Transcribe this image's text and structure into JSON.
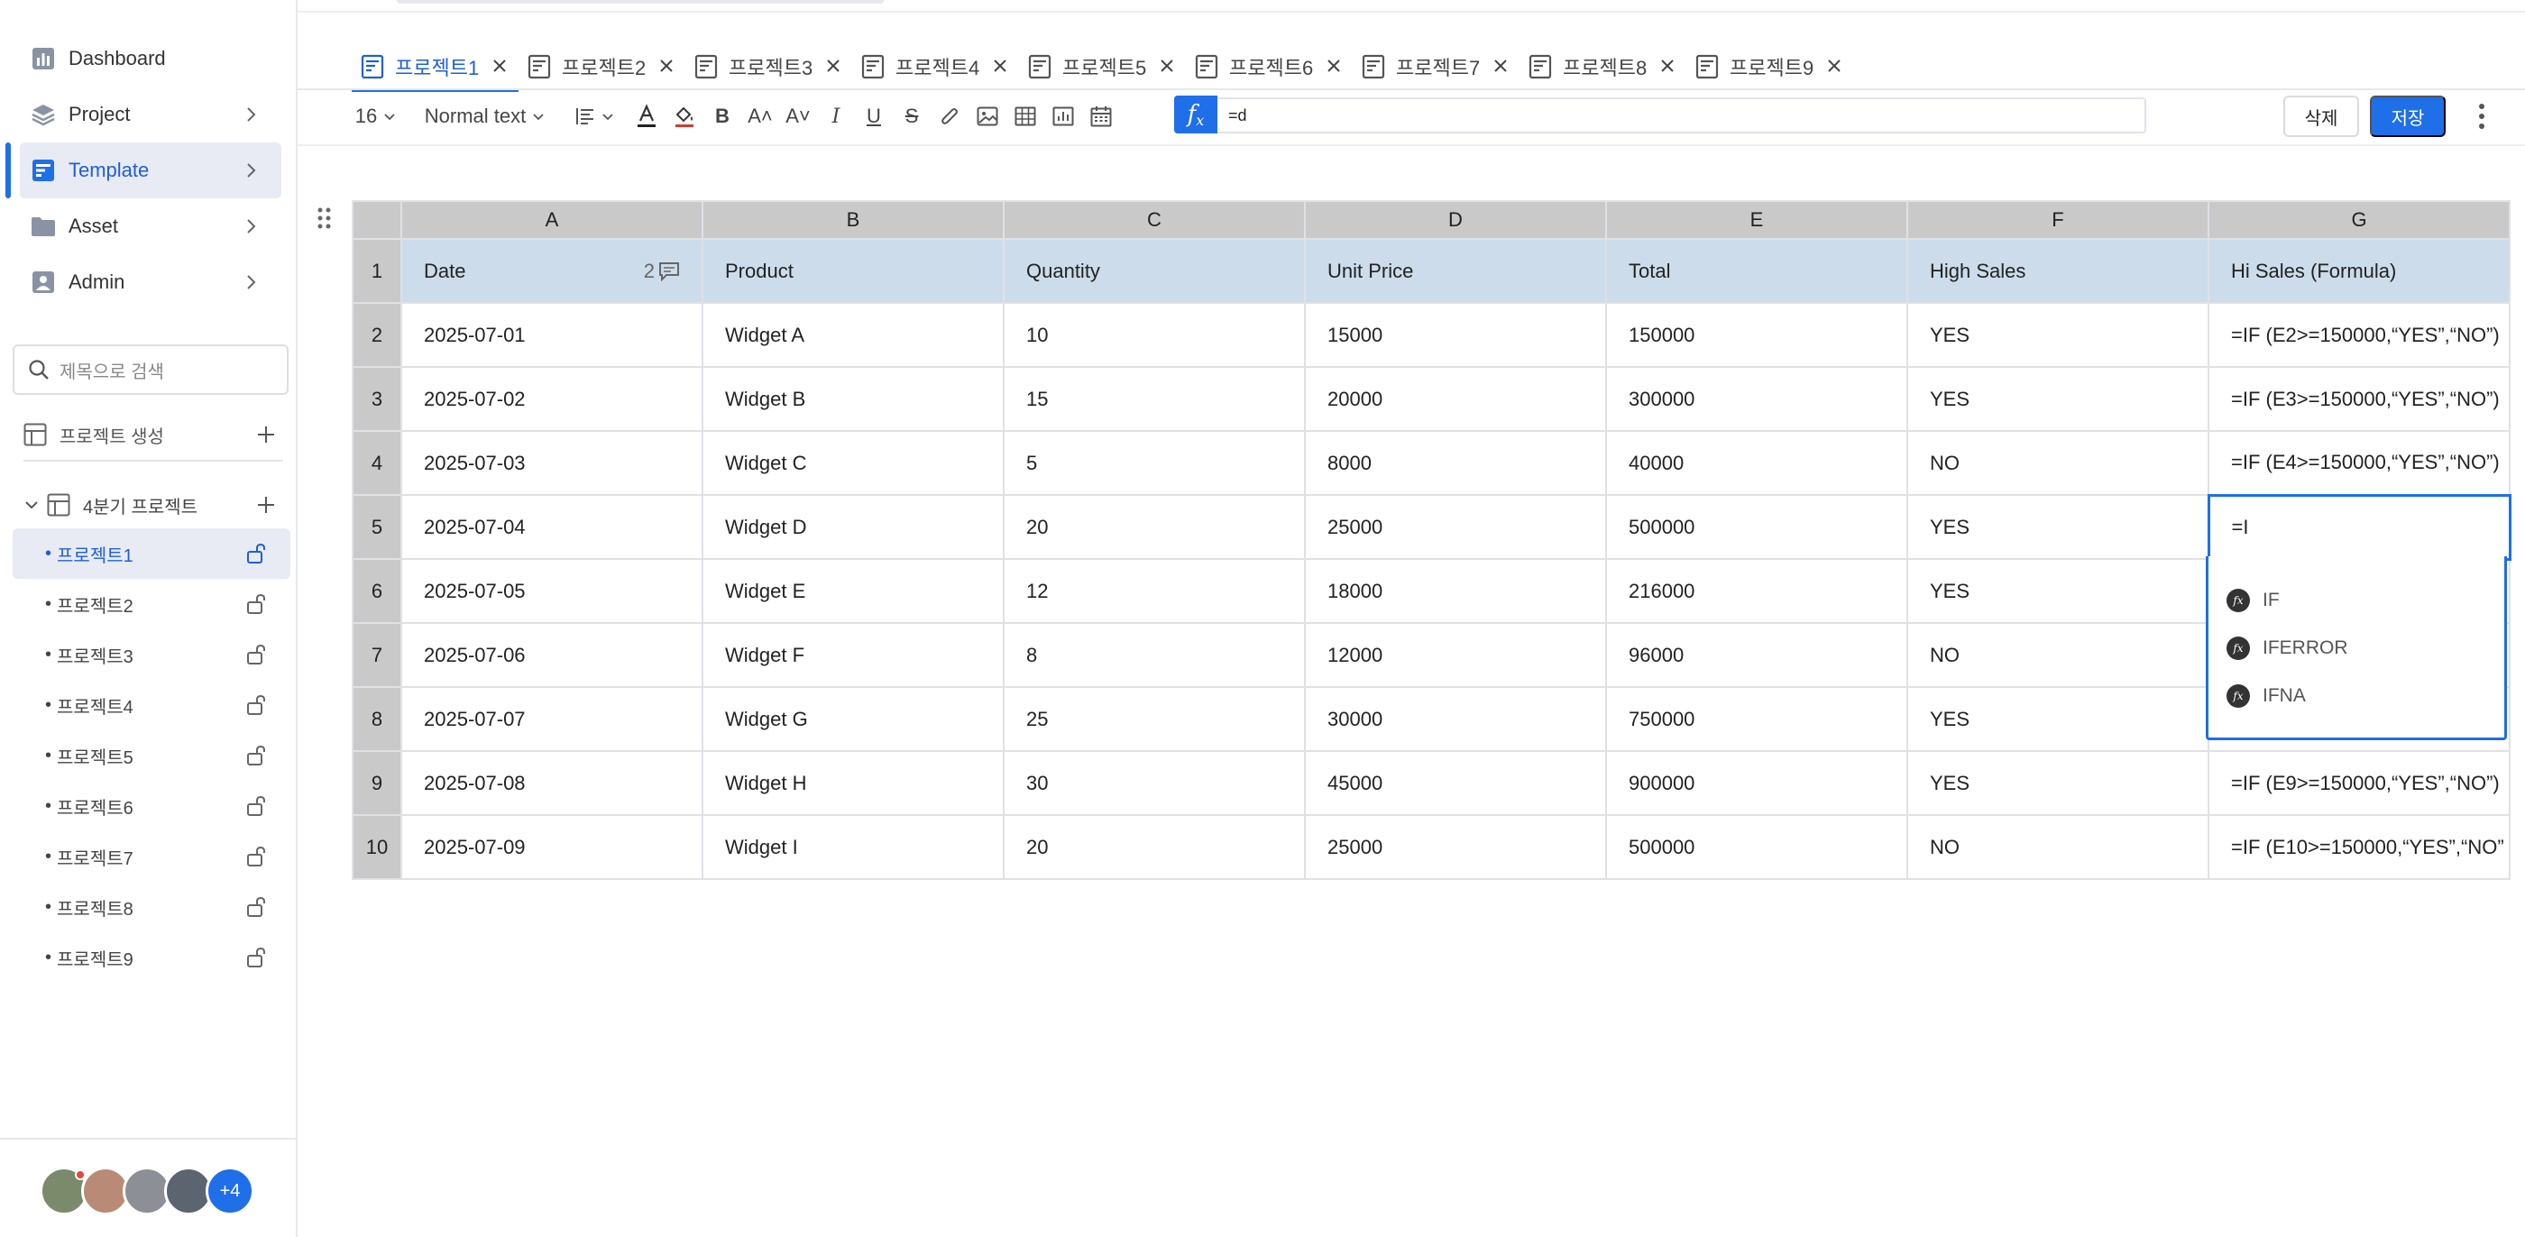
{
  "sidebar": {
    "nav": [
      {
        "label": "Dashboard",
        "icon": "dashboard-icon"
      },
      {
        "label": "Project",
        "icon": "layers-icon"
      },
      {
        "label": "Template",
        "icon": "template-icon"
      },
      {
        "label": "Asset",
        "icon": "folder-icon"
      },
      {
        "label": "Admin",
        "icon": "user-icon"
      }
    ],
    "search_placeholder": "제목으로 검색",
    "create_project": "프로젝트 생성",
    "folder": "4분기 프로젝트",
    "projects": [
      "프로젝트1",
      "프로젝트2",
      "프로젝트3",
      "프로젝트4",
      "프로젝트5",
      "프로젝트6",
      "프로젝트7",
      "프로젝트8",
      "프로젝트9"
    ],
    "more_users": "+4"
  },
  "tabs": [
    "프로젝트1",
    "프로젝트2",
    "프로젝트3",
    "프로젝트4",
    "프로젝트5",
    "프로젝트6",
    "프로젝트7",
    "프로젝트8",
    "프로젝트9"
  ],
  "toolbar": {
    "font_size": "16",
    "text_style": "Normal text",
    "formula_value": "=d",
    "delete_label": "삭제",
    "save_label": "저장",
    "accent_color": "#1e6fe8"
  },
  "sheet": {
    "columns": [
      "A",
      "B",
      "C",
      "D",
      "E",
      "F",
      "G"
    ],
    "comment_count": "2",
    "rows": [
      {
        "num": "1",
        "cells": [
          "Date",
          "Product",
          "Quantity",
          "Unit Price",
          "Total",
          "High Sales",
          "Hi Sales (Formula)"
        ]
      },
      {
        "num": "2",
        "cells": [
          "2025-07-01",
          "Widget A",
          "10",
          "15000",
          "150000",
          "YES",
          "=IF (E2>=150000,“YES”,“NO”)"
        ]
      },
      {
        "num": "3",
        "cells": [
          "2025-07-02",
          "Widget B",
          "15",
          "20000",
          "300000",
          "YES",
          "=IF (E3>=150000,“YES”,“NO”)"
        ]
      },
      {
        "num": "4",
        "cells": [
          "2025-07-03",
          "Widget C",
          "5",
          "8000",
          "40000",
          "NO",
          "=IF (E4>=150000,“YES”,“NO”)"
        ]
      },
      {
        "num": "5",
        "cells": [
          "2025-07-04",
          "Widget D",
          "20",
          "25000",
          "500000",
          "YES",
          "=I"
        ]
      },
      {
        "num": "6",
        "cells": [
          "2025-07-05",
          "Widget E",
          "12",
          "18000",
          "216000",
          "YES",
          ""
        ]
      },
      {
        "num": "7",
        "cells": [
          "2025-07-06",
          "Widget F",
          "8",
          "12000",
          "96000",
          "NO",
          ""
        ]
      },
      {
        "num": "8",
        "cells": [
          "2025-07-07",
          "Widget G",
          "25",
          "30000",
          "750000",
          "YES",
          ""
        ]
      },
      {
        "num": "9",
        "cells": [
          "2025-07-08",
          "Widget H",
          "30",
          "45000",
          "900000",
          "YES",
          "=IF (E9>=150000,“YES”,“NO”)"
        ]
      },
      {
        "num": "10",
        "cells": [
          "2025-07-09",
          "Widget I",
          "20",
          "25000",
          "500000",
          "NO",
          "=IF (E10>=150000,“YES”,“NO”"
        ]
      }
    ],
    "autocomplete": [
      "IF",
      "IFERROR",
      "IFNA"
    ]
  }
}
